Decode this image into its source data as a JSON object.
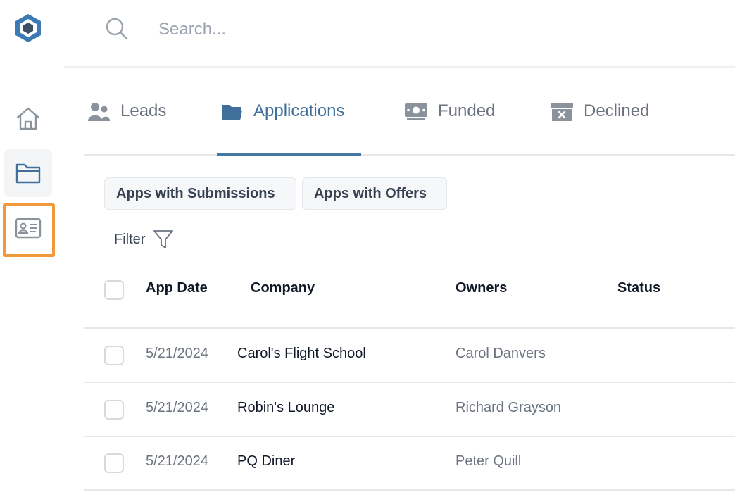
{
  "search": {
    "placeholder": "Search..."
  },
  "tabs": [
    {
      "label": "Leads",
      "icon": "users-icon",
      "active": false
    },
    {
      "label": "Applications",
      "icon": "folder-icon",
      "active": true
    },
    {
      "label": "Funded",
      "icon": "money-icon",
      "active": false
    },
    {
      "label": "Declined",
      "icon": "archive-x-icon",
      "active": false
    }
  ],
  "chips": {
    "submissions": "Apps with Submissions",
    "offers": "Apps with Offers"
  },
  "filter": {
    "label": "Filter"
  },
  "table": {
    "headers": {
      "date": "App Date",
      "company": "Company",
      "owners": "Owners",
      "status": "Status"
    },
    "rows": [
      {
        "date": "5/21/2024",
        "company": "Carol's Flight School",
        "owner": "Carol Danvers",
        "status": ""
      },
      {
        "date": "5/21/2024",
        "company": "Robin's Lounge",
        "owner": "Richard Grayson",
        "status": ""
      },
      {
        "date": "5/21/2024",
        "company": "PQ Diner",
        "owner": "Peter Quill",
        "status": ""
      }
    ]
  },
  "colors": {
    "accent": "#4479a6",
    "highlight": "#f0983a",
    "muted": "#6b7280"
  }
}
